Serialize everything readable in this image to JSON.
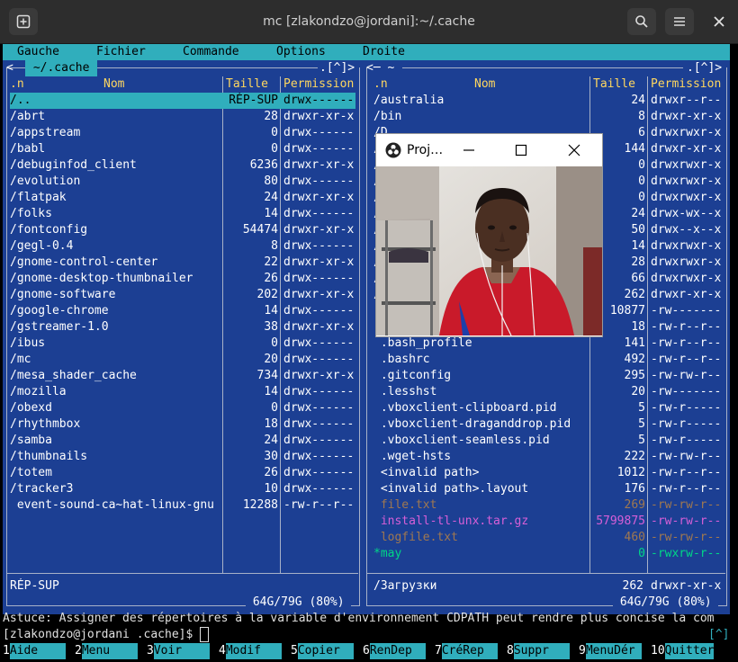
{
  "window": {
    "title": "mc [zlakondzo@jordani]:~/.cache"
  },
  "menu": [
    "Gauche",
    "Fichier",
    "Commande",
    "Options",
    "Droite"
  ],
  "left_panel": {
    "path_label": " ~/.cache ",
    "corner": ".[^]>",
    "header": {
      "sort": ".n",
      "name": "Nom",
      "size": "Taille",
      "perm": "Permission"
    },
    "rows": [
      {
        "name": "/..",
        "size": "RÉP-SUP",
        "perm": "drwx------",
        "selected": true
      },
      {
        "name": "/abrt",
        "size": "28",
        "perm": "drwxr-xr-x"
      },
      {
        "name": "/appstream",
        "size": "0",
        "perm": "drwx------"
      },
      {
        "name": "/babl",
        "size": "0",
        "perm": "drwx------"
      },
      {
        "name": "/debuginfod_client",
        "size": "6236",
        "perm": "drwxr-xr-x"
      },
      {
        "name": "/evolution",
        "size": "80",
        "perm": "drwx------"
      },
      {
        "name": "/flatpak",
        "size": "24",
        "perm": "drwxr-xr-x"
      },
      {
        "name": "/folks",
        "size": "14",
        "perm": "drwx------"
      },
      {
        "name": "/fontconfig",
        "size": "54474",
        "perm": "drwxr-xr-x"
      },
      {
        "name": "/gegl-0.4",
        "size": "8",
        "perm": "drwx------"
      },
      {
        "name": "/gnome-control-center",
        "size": "22",
        "perm": "drwxr-xr-x"
      },
      {
        "name": "/gnome-desktop-thumbnailer",
        "size": "26",
        "perm": "drwx------"
      },
      {
        "name": "/gnome-software",
        "size": "202",
        "perm": "drwxr-xr-x"
      },
      {
        "name": "/google-chrome",
        "size": "14",
        "perm": "drwx------"
      },
      {
        "name": "/gstreamer-1.0",
        "size": "38",
        "perm": "drwxr-xr-x"
      },
      {
        "name": "/ibus",
        "size": "0",
        "perm": "drwx------"
      },
      {
        "name": "/mc",
        "size": "20",
        "perm": "drwx------"
      },
      {
        "name": "/mesa_shader_cache",
        "size": "734",
        "perm": "drwxr-xr-x"
      },
      {
        "name": "/mozilla",
        "size": "14",
        "perm": "drwx------"
      },
      {
        "name": "/obexd",
        "size": "0",
        "perm": "drwx------"
      },
      {
        "name": "/rhythmbox",
        "size": "18",
        "perm": "drwx------"
      },
      {
        "name": "/samba",
        "size": "24",
        "perm": "drwx------"
      },
      {
        "name": "/thumbnails",
        "size": "30",
        "perm": "drwx------"
      },
      {
        "name": "/totem",
        "size": "26",
        "perm": "drwx------"
      },
      {
        "name": "/tracker3",
        "size": "10",
        "perm": "drwx------"
      },
      {
        "name": " event-sound-ca~hat-linux-gnu",
        "size": "12288",
        "perm": "-rw-r--r--"
      }
    ],
    "status": "RÉP-SUP",
    "disk": " 64G/79G (80%) "
  },
  "right_panel": {
    "path_label": "<─ ~ ",
    "corner": ".[^]>",
    "header": {
      "sort": ".n",
      "name": "Nom",
      "size": "Taille",
      "perm": "Permission"
    },
    "rows": [
      {
        "name": "/australia",
        "size": "24",
        "perm": "drwxr--r--",
        "color": "#ffffff"
      },
      {
        "name": "/bin",
        "size": "8",
        "perm": "drwxr-xr-x",
        "color": "#ffffff"
      },
      {
        "name": "/D",
        "size": "6",
        "perm": "drwxrwxr-x",
        "color": "#ffffff"
      },
      {
        "name": "/",
        "size": "144",
        "perm": "drwxr-xr-x",
        "color": "#ffffff"
      },
      {
        "name": "/",
        "size": "0",
        "perm": "drwxrwxr-x",
        "color": "#ffffff"
      },
      {
        "name": "/",
        "size": "0",
        "perm": "drwxrwxr-x",
        "color": "#ffffff"
      },
      {
        "name": "/",
        "size": "0",
        "perm": "drwxrwxr-x",
        "color": "#ffffff"
      },
      {
        "name": "/",
        "size": "24",
        "perm": "drwx-wx--x",
        "color": "#ffffff"
      },
      {
        "name": "/",
        "size": "50",
        "perm": "drwx--x--x",
        "color": "#ffffff"
      },
      {
        "name": "/",
        "size": "14",
        "perm": "drwxrwxr-x",
        "color": "#ffffff"
      },
      {
        "name": "/",
        "size": "28",
        "perm": "drwxrwxr-x",
        "color": "#ffffff"
      },
      {
        "name": "/",
        "size": "66",
        "perm": "drwxrwxr-x",
        "color": "#ffffff"
      },
      {
        "name": "/",
        "size": "262",
        "perm": "drwxr-xr-x",
        "color": "#ffffff"
      },
      {
        "name": "",
        "size": "10877",
        "perm": "-rw-------",
        "color": "#ffffff"
      },
      {
        "name": "",
        "size": "18",
        "perm": "-rw-r--r--",
        "color": "#ffffff"
      },
      {
        "name": " .bash_profile",
        "size": "141",
        "perm": "-rw-r--r--",
        "color": "#ffffff"
      },
      {
        "name": " .bashrc",
        "size": "492",
        "perm": "-rw-r--r--",
        "color": "#ffffff"
      },
      {
        "name": " .gitconfig",
        "size": "295",
        "perm": "-rw-rw-r--",
        "color": "#ffffff"
      },
      {
        "name": " .lesshst",
        "size": "20",
        "perm": "-rw-------",
        "color": "#ffffff"
      },
      {
        "name": " .vboxclient-clipboard.pid",
        "size": "5",
        "perm": "-rw-r-----",
        "color": "#ffffff"
      },
      {
        "name": " .vboxclient-draganddrop.pid",
        "size": "5",
        "perm": "-rw-r-----",
        "color": "#ffffff"
      },
      {
        "name": " .vboxclient-seamless.pid",
        "size": "5",
        "perm": "-rw-r-----",
        "color": "#ffffff"
      },
      {
        "name": " .wget-hsts",
        "size": "222",
        "perm": "-rw-rw-r--",
        "color": "#ffffff"
      },
      {
        "name": " <invalid path>",
        "size": "1012",
        "perm": "-rw-r--r--",
        "color": "#ffffff"
      },
      {
        "name": " <invalid path>.layout",
        "size": "176",
        "perm": "-rw-r--r--",
        "color": "#ffffff"
      },
      {
        "name": " file.txt",
        "size": "269",
        "perm": "-rw-rw-r--",
        "color": "#a07850"
      },
      {
        "name": " install-tl-unx.tar.gz",
        "size": "5799875",
        "perm": "-rw-rw-r--",
        "color": "#d75fd7"
      },
      {
        "name": " logfile.txt",
        "size": "460",
        "perm": "-rw-rw-r--",
        "color": "#a07850"
      },
      {
        "name": "*may",
        "size": "0",
        "perm": "-rwxrw-r--",
        "color": "#00d787"
      }
    ],
    "status": "/Загрузки",
    "status_size": "262",
    "status_perm": "drwxr-xr-x",
    "disk": " 64G/79G (80%) "
  },
  "hint": "Astuce: Assigner des répertoires à la variable d'environnement CDPATH peut rendre plus concise la com",
  "prompt": "[zlakondzo@jordani .cache]$ ",
  "prompt_corner": "[^]",
  "fkeys": [
    {
      "n": "1",
      "l": "Aide"
    },
    {
      "n": "2",
      "l": "Menu"
    },
    {
      "n": "3",
      "l": "Voir"
    },
    {
      "n": "4",
      "l": "Modif"
    },
    {
      "n": "5",
      "l": "Copier"
    },
    {
      "n": "6",
      "l": "RenDep"
    },
    {
      "n": "7",
      "l": "CréRep"
    },
    {
      "n": "8",
      "l": "Suppr"
    },
    {
      "n": "9",
      "l": "MenuDér"
    },
    {
      "n": "10",
      "l": "Quitter"
    }
  ],
  "overlay": {
    "title": "Proj…"
  },
  "colors": {
    "panel_bg": "#1c3f93",
    "menubar_bg": "#30aebc",
    "header_fg": "#ffd75f"
  }
}
